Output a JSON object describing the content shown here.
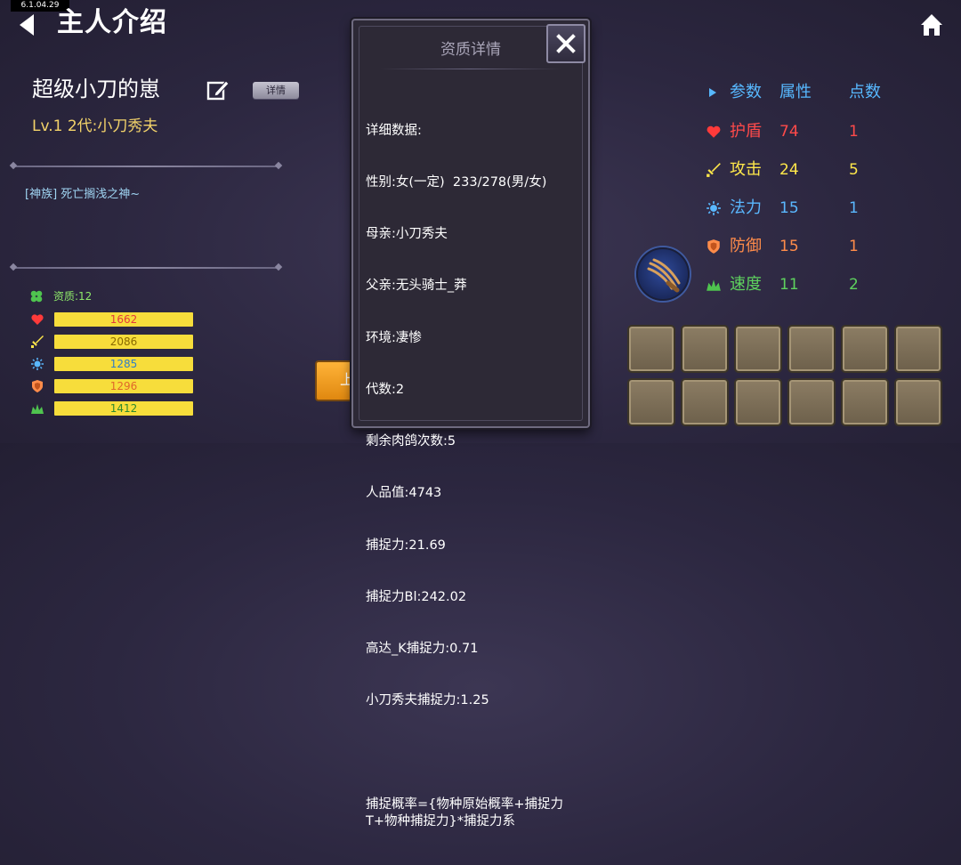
{
  "version": "6.1.04.29",
  "header": {
    "title": "主人介绍"
  },
  "character": {
    "name": "超级小刀的崽",
    "detail_button": "详情",
    "level_line": "Lv.1 2代:小刀秀夫",
    "tribe": "[神族] 死亡搁浅之神~",
    "aptitude": "资质:12"
  },
  "stat_bars": [
    {
      "icon": "heart-icon",
      "value": "1662",
      "color": "#e23b3b"
    },
    {
      "icon": "sword-icon",
      "value": "2086",
      "color": "#8a6a00"
    },
    {
      "icon": "magic-icon",
      "value": "1285",
      "color": "#2f7ec9"
    },
    {
      "icon": "shield-icon",
      "value": "1296",
      "color": "#e0682a"
    },
    {
      "icon": "speed-icon",
      "value": "1412",
      "color": "#2e8a2e"
    }
  ],
  "go_button": "上",
  "modal": {
    "title": "资质详情",
    "close_label": "✕",
    "lines": [
      "详细数据:",
      "性别:女(一定)  233/278(男/女)",
      "母亲:小刀秀夫",
      "父亲:无头骑士_莽",
      "环境:凄惨",
      "代数:2",
      "剩余肉鸽次数:5",
      "人品值:4743",
      "捕捉力:21.69",
      "捕捉力Bl:242.02",
      "高达_K捕捉力:0.71",
      "小刀秀夫捕捉力:1.25",
      "",
      "捕捉概率={物种原始概率+捕捉力T+物种捕捉力}*捕捉力系"
    ]
  },
  "params": {
    "headers": {
      "param": "参数",
      "attr": "属性",
      "points": "点数"
    },
    "rows": [
      {
        "icon": "heart-icon",
        "name": "护盾",
        "attr": "74",
        "points": "1",
        "color": "#ff4a4a"
      },
      {
        "icon": "sword-icon",
        "name": "攻击",
        "attr": "24",
        "points": "5",
        "color": "#ffe84a"
      },
      {
        "icon": "magic-icon",
        "name": "法力",
        "attr": "15",
        "points": "1",
        "color": "#5ab8ff"
      },
      {
        "icon": "shield-icon",
        "name": "防御",
        "attr": "15",
        "points": "1",
        "color": "#ff8c4a"
      },
      {
        "icon": "speed-icon",
        "name": "速度",
        "attr": "11",
        "points": "2",
        "color": "#5ed25e"
      }
    ]
  },
  "inventory_slots": 12
}
